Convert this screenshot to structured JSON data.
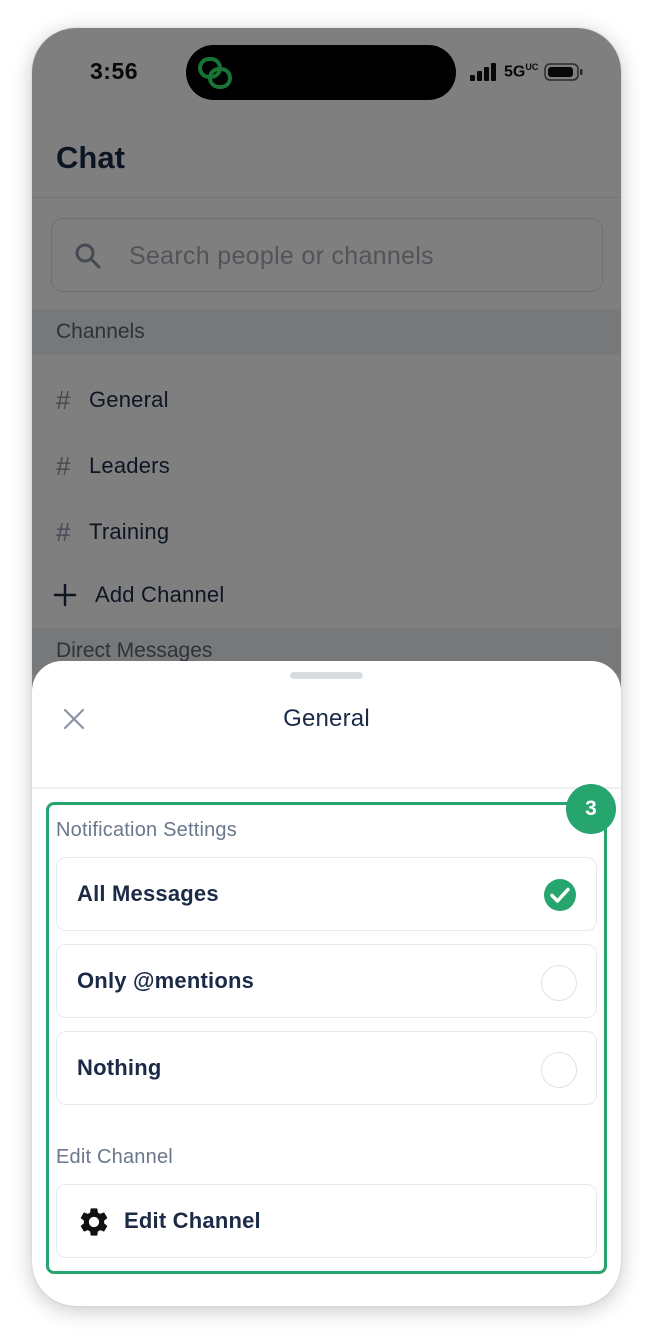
{
  "status_bar": {
    "time": "3:56",
    "network": "5G",
    "network_superscript": "UC"
  },
  "header": {
    "title": "Chat"
  },
  "search": {
    "placeholder": "Search people or channels"
  },
  "sections": {
    "channels_label": "Channels",
    "direct_messages_label": "Direct Messages"
  },
  "channels": [
    {
      "prefix": "#",
      "name": "General"
    },
    {
      "prefix": "#",
      "name": "Leaders"
    },
    {
      "prefix": "#",
      "name": "Training"
    }
  ],
  "add_channel": {
    "label": "Add Channel"
  },
  "sheet": {
    "title": "General",
    "step_badge": "3",
    "notification_label": "Notification Settings",
    "options": [
      {
        "label": "All Messages",
        "selected": true
      },
      {
        "label": "Only @mentions",
        "selected": false
      },
      {
        "label": "Nothing",
        "selected": false
      }
    ],
    "edit_section_label": "Edit Channel",
    "edit_button_label": "Edit Channel"
  },
  "colors": {
    "accent": "#27a56f",
    "text_primary": "#1b2a47",
    "text_secondary": "#6b778c",
    "island_icon": "#2ee86a"
  },
  "icons": {
    "island": "linked-rings-icon",
    "search": "search-icon",
    "add": "plus-icon",
    "close": "close-icon",
    "selected": "check-circle-icon",
    "edit": "gear-icon"
  }
}
